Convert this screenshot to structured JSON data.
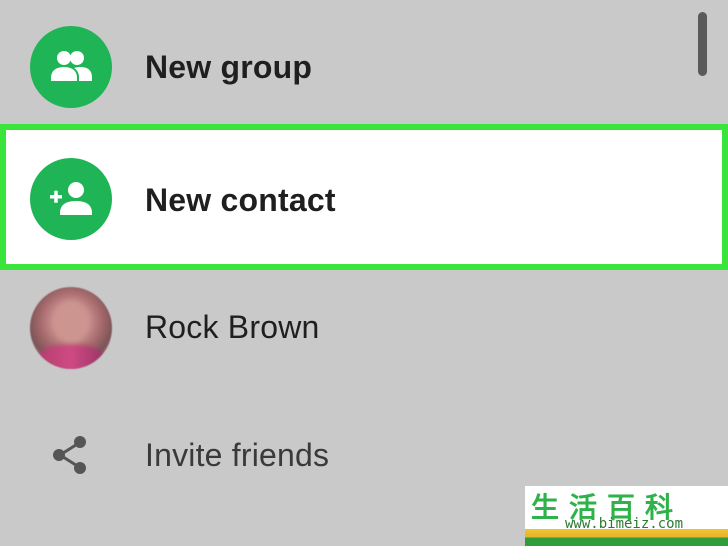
{
  "menu": {
    "items": [
      {
        "label": "New group",
        "icon": "group-icon",
        "highlighted": false
      },
      {
        "label": "New contact",
        "icon": "add-contact-icon",
        "highlighted": true
      },
      {
        "label": "Rock Brown",
        "icon": "contact-avatar",
        "highlighted": false
      },
      {
        "label": "Invite friends",
        "icon": "share-icon",
        "highlighted": false
      }
    ]
  },
  "watermark": {
    "title": "生活百科",
    "url": "www.bimeiz.com"
  },
  "colors": {
    "accent_green": "#1fb456",
    "highlight_border": "#39e53a",
    "background": "#c9c9c9",
    "highlight_background": "#ffffff"
  }
}
